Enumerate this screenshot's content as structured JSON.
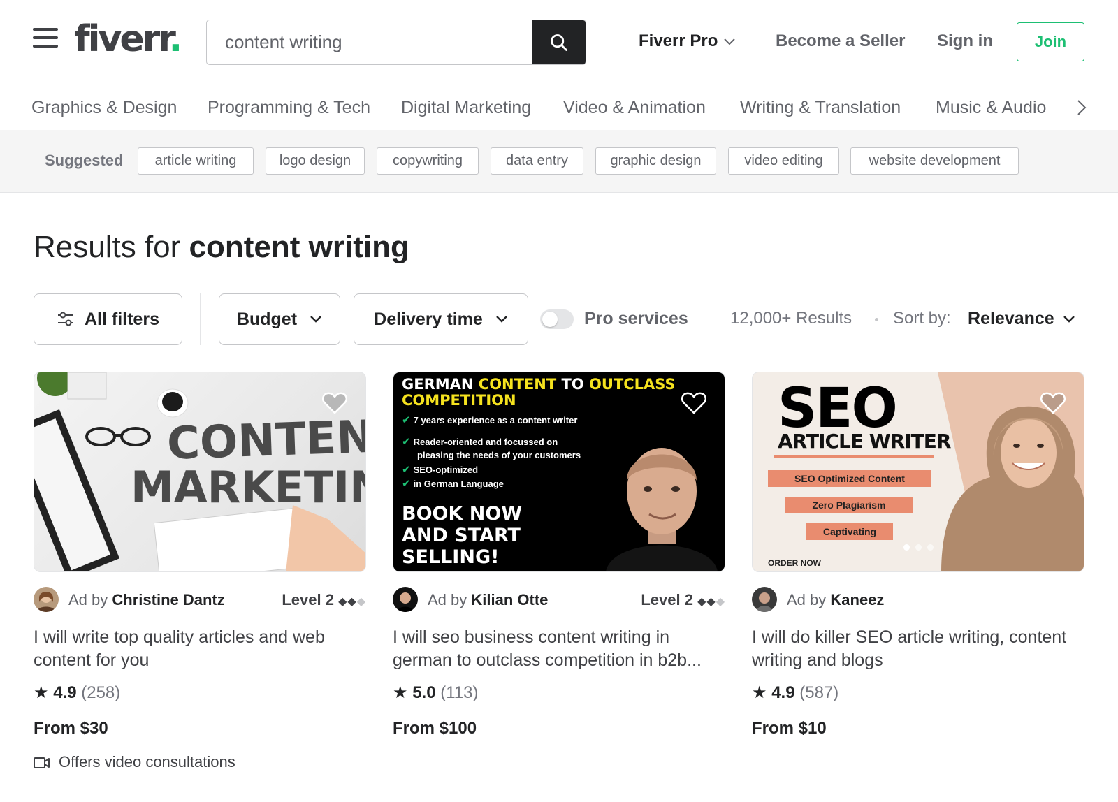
{
  "header": {
    "logo": "fiverr",
    "logo_dot": ".",
    "search_value": "content writing",
    "nav": {
      "pro": "Fiverr Pro",
      "become_seller": "Become a Seller",
      "sign_in": "Sign in",
      "join": "Join"
    }
  },
  "categories": [
    "Graphics & Design",
    "Programming & Tech",
    "Digital Marketing",
    "Video & Animation",
    "Writing & Translation",
    "Music & Audio"
  ],
  "suggested": {
    "label": "Suggested",
    "tags": [
      "article writing",
      "logo design",
      "copywriting",
      "data entry",
      "graphic design",
      "video editing",
      "website development"
    ]
  },
  "results": {
    "prefix": "Results for",
    "query": "content writing"
  },
  "filters": {
    "all_filters": "All filters",
    "budget": "Budget",
    "delivery_time": "Delivery time",
    "pro_services": "Pro services",
    "count": "12,000+ Results",
    "sort_label": "Sort by:",
    "sort_value": "Relevance"
  },
  "gigs": [
    {
      "ad_prefix": "Ad by",
      "seller": "Christine Dantz",
      "level": "Level 2",
      "title": "I will write top quality articles and web content for you",
      "rating": "4.9",
      "reviews": "(258)",
      "price": "From $30",
      "extra": "Offers video consultations",
      "thumb": {
        "line1": "CONTENT",
        "line2": "MARKETING"
      }
    },
    {
      "ad_prefix": "Ad by",
      "seller": "Kilian Otte",
      "level": "Level 2",
      "title": "I will seo business content writing in german to outclass competition in b2b...",
      "rating": "5.0",
      "reviews": "(113)",
      "price": "From $100",
      "thumb": {
        "h_white1": "GERMAN ",
        "h_yellow1": "CONTENT",
        "h_white2": " TO ",
        "h_yellow2": "OUTCLASS",
        "h_yellow3": "COMPETITION",
        "bullets": [
          "7 years experience as a content writer",
          "Reader-oriented and focussed on",
          "pleasing the needs of your customers",
          "SEO-optimized",
          "in German Language"
        ],
        "cta1": "BOOK NOW",
        "cta2": "AND START",
        "cta3": "SELLING!"
      }
    },
    {
      "ad_prefix": "Ad by",
      "seller": "Kaneez",
      "title": "I will do killer SEO article writing, content writing and blogs",
      "rating": "4.9",
      "reviews": "(587)",
      "price": "From $10",
      "thumb": {
        "big": "SEO",
        "sub": "ARTICLE WRITER",
        "pills": [
          "SEO Optimized Content",
          "Zero Plagiarism",
          "Captivating"
        ],
        "order": "ORDER NOW"
      }
    }
  ],
  "colors": {
    "brand_green": "#1dbf73",
    "text": "#404145",
    "muted": "#74767e"
  }
}
